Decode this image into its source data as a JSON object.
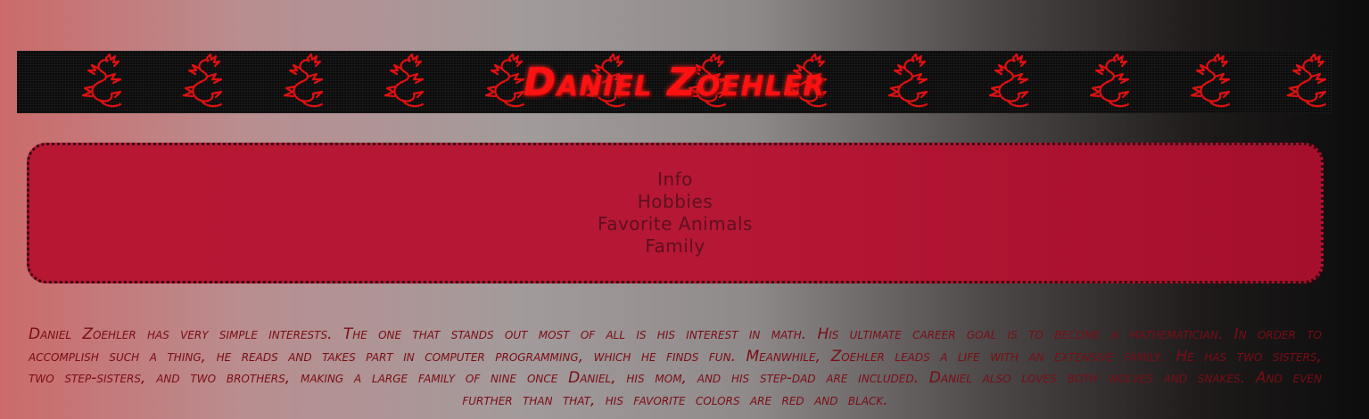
{
  "banner": {
    "title": "Daniel Zoehler",
    "dragon_icon": "red-dragon-icon",
    "dragon_color": "#e01010",
    "background_color": "#0b0b0b"
  },
  "nav": {
    "items": [
      {
        "label": "Info"
      },
      {
        "label": "Hobbies"
      },
      {
        "label": "Favorite Animals"
      },
      {
        "label": "Family"
      }
    ],
    "background_color": "#b71733",
    "text_color": "#5e1020"
  },
  "bio": {
    "text": "Daniel Zoehler has very simple interests. The one that stands out most of all is his interest in math. His ultimate career goal is to become a mathematician. In order to accomplish such a thing, he reads and takes part in computer programming, which he finds fun. Meanwhile, Zoehler leads a life with an extensive family. He has two sisters, two step-sisters, and two brothers, making a large family of nine once Daniel, his mom, and his step-dad are included. Daniel also loves both wolves and snakes. And even further than that, his favorite colors are red and black."
  }
}
